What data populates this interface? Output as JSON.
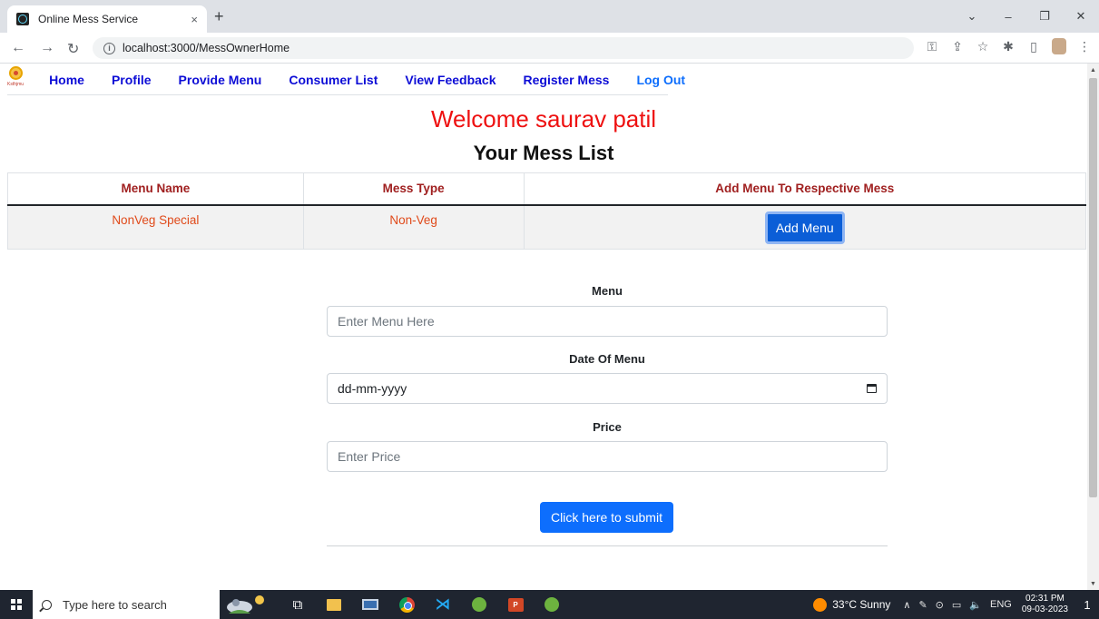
{
  "browser": {
    "tab_title": "Online Mess Service",
    "tab_close": "×",
    "new_tab": "+",
    "url": "localhost:3000/MessOwnerHome",
    "win_minimize": "–",
    "win_maximize": "❐",
    "win_close": "✕",
    "win_dropdown": "⌄"
  },
  "navbar": {
    "logo_text": "Ksthjmu",
    "links": [
      "Home",
      "Profile",
      "Provide Menu",
      "Consumer List",
      "View Feedback",
      "Register Mess",
      "Log Out"
    ]
  },
  "page": {
    "welcome": "Welcome saurav patil",
    "list_title": "Your Mess List"
  },
  "table": {
    "headers": [
      "Menu Name",
      "Mess Type",
      "Add Menu To Respective Mess"
    ],
    "rows": [
      {
        "menu_name": "NonVeg Special",
        "mess_type": "Non-Veg",
        "action_label": "Add Menu"
      }
    ]
  },
  "form": {
    "menu_label": "Menu",
    "menu_placeholder": "Enter Menu Here",
    "date_label": "Date Of Menu",
    "date_value": "dd-mm-yyyy",
    "price_label": "Price",
    "price_placeholder": "Enter Price",
    "submit_label": "Click here to submit"
  },
  "taskbar": {
    "search_placeholder": "Type here to search",
    "weather": "33°C  Sunny",
    "language": "ENG",
    "time": "02:31 PM",
    "date": "09-03-2023",
    "notification_count": "1"
  },
  "colors": {
    "welcome": "#ee1111",
    "nav_link": "#0d0dd6",
    "table_header": "#a02020",
    "table_cell": "#e04a1a",
    "primary_button": "#0d6efd"
  }
}
